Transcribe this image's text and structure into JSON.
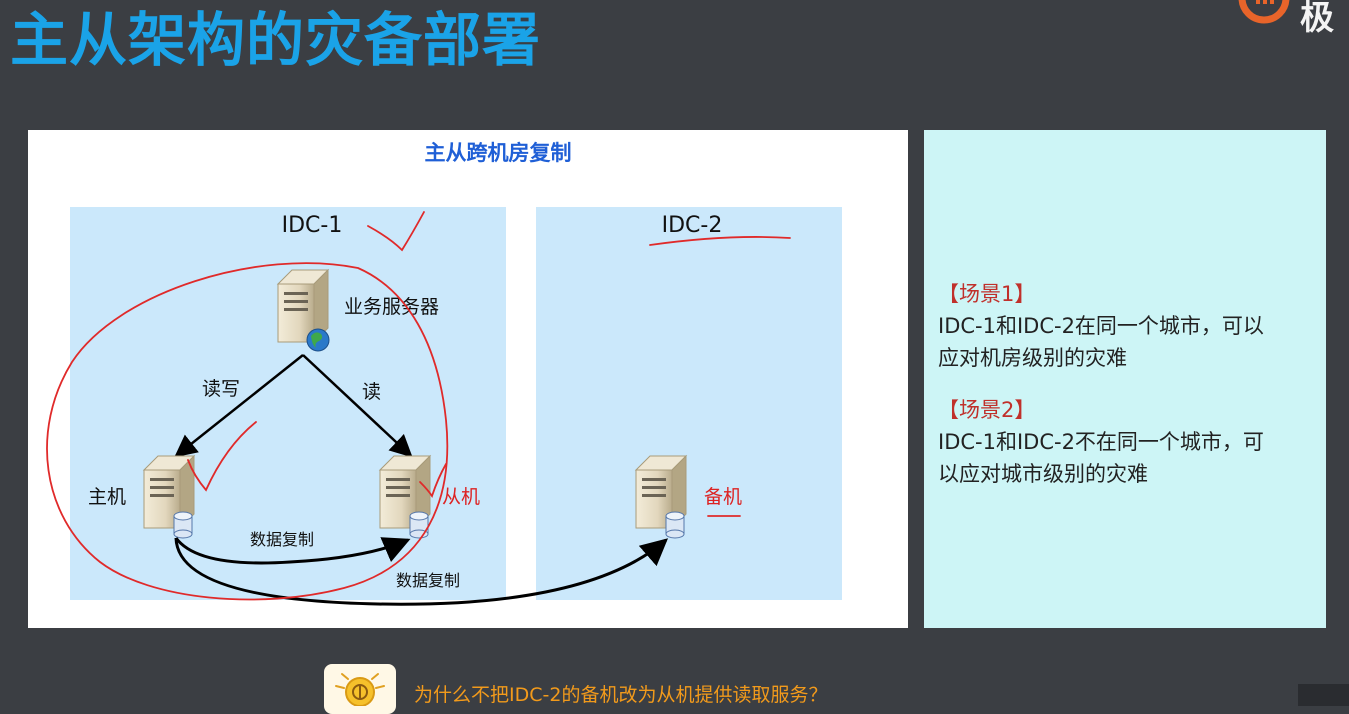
{
  "page": {
    "title": "主从架构的灾备部署",
    "logo_text": "极"
  },
  "diagram": {
    "title": "主从跨机房复制",
    "idc1_label": "IDC-1",
    "idc2_label": "IDC-2",
    "app_server_label": "业务服务器",
    "read_write_label": "读写",
    "read_label": "读",
    "master_label": "主机",
    "slave_label": "从机",
    "backup_label": "备机",
    "replication_label_1": "数据复制",
    "replication_label_2": "数据复制"
  },
  "notes": {
    "scene1_title": "【场景1】",
    "scene1_line1": "IDC-1和IDC-2在同一个城市，可以",
    "scene1_line2": "应对机房级别的灾难",
    "scene2_title": "【场景2】",
    "scene2_line1": "IDC-1和IDC-2不在同一个城市，可",
    "scene2_line2": "以应对城市级别的灾难"
  },
  "question": {
    "text": "为什么不把IDC-2的备机改为从机提供读取服务？"
  },
  "colors": {
    "title": "#1aa3e8",
    "diagram_title": "#1f5fd6",
    "idc_bg": "#cbe8fb",
    "annotation_red": "#e02a2a",
    "scene_title": "#c0302b",
    "question": "#f29a1b"
  },
  "icons": [
    "server-icon",
    "globe-icon",
    "database-icon",
    "lightbulb-icon",
    "logo-icon"
  ]
}
